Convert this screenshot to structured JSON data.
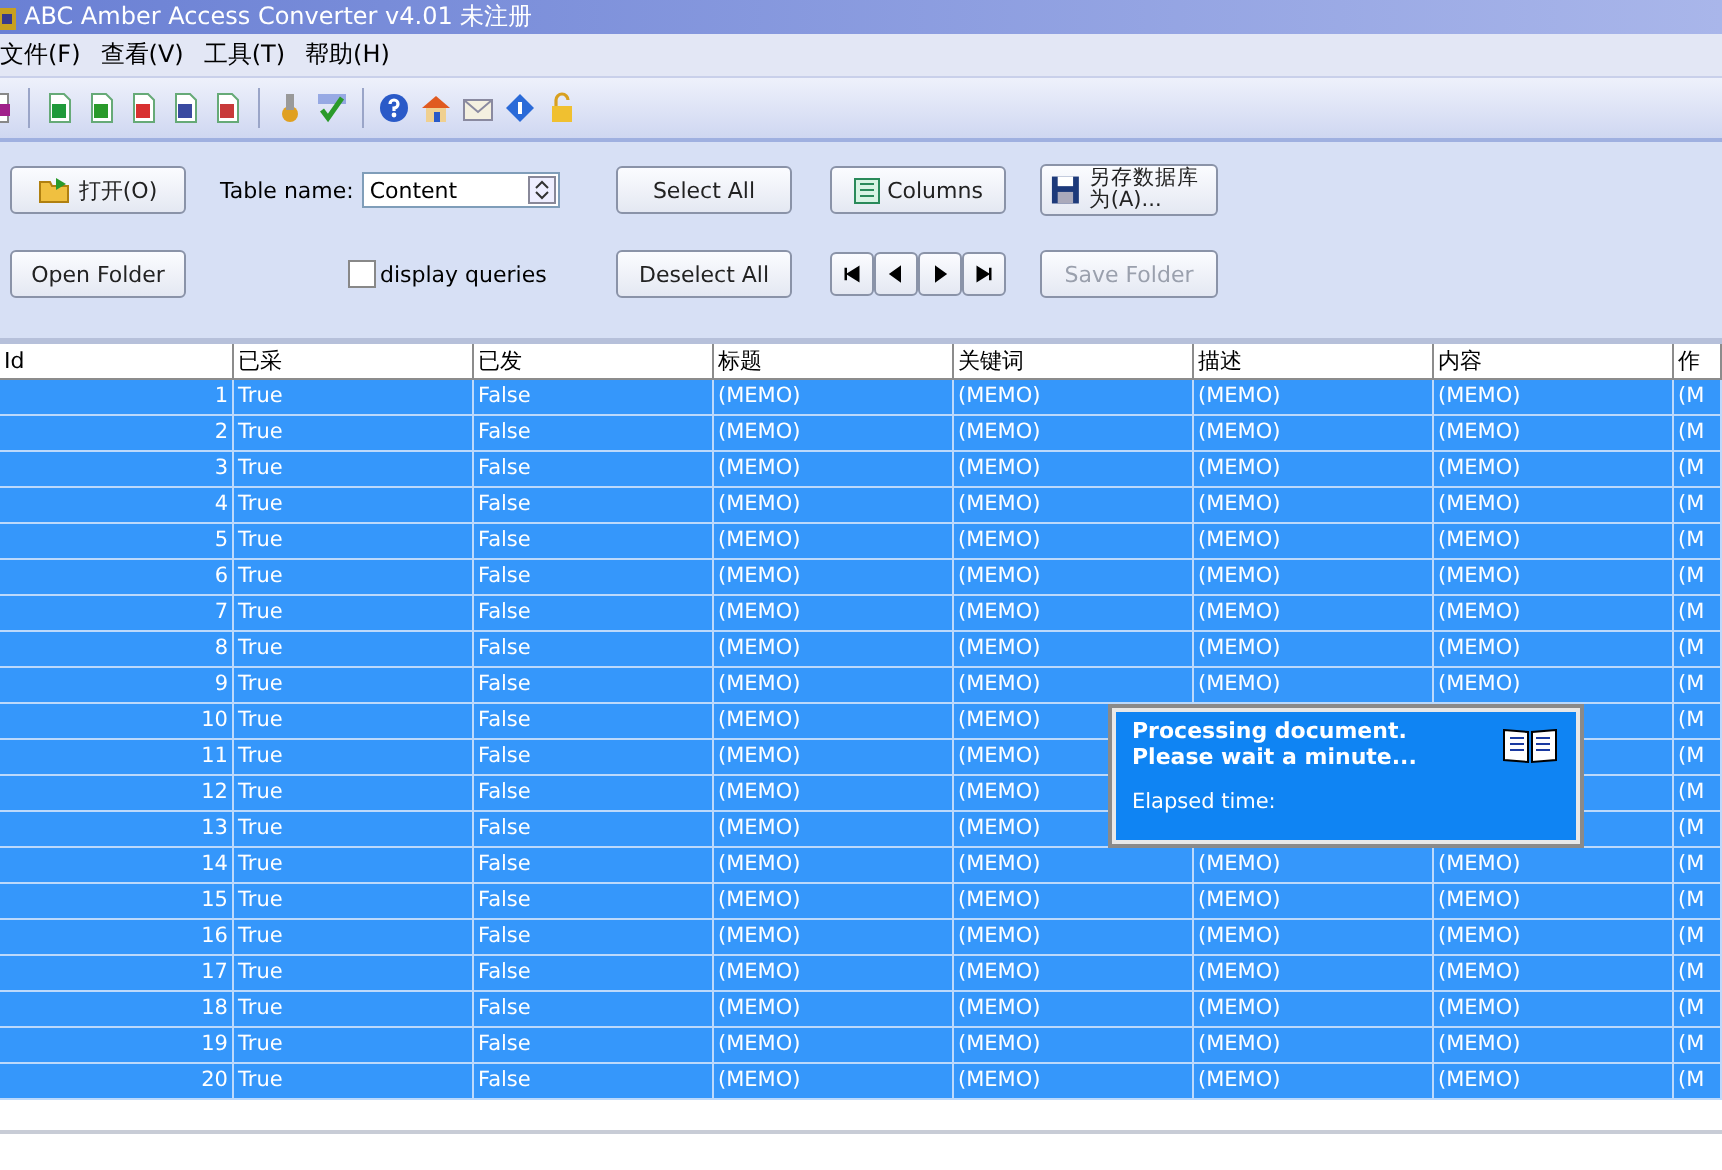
{
  "window": {
    "title": "ABC Amber Access Converter v4.01 未注册"
  },
  "menu": [
    "文件(F)",
    "查看(V)",
    "工具(T)",
    "帮助(H)"
  ],
  "controls": {
    "open_button": "打开(O)",
    "table_label": "Table name:",
    "table_select": "Content",
    "select_all": "Select All",
    "columns_button": "Columns",
    "save_db_button": "另存数据库为(A)...",
    "open_folder": "Open Folder",
    "display_queries": {
      "label": "display queries",
      "checked": false
    },
    "deselect_all": "Deselect All",
    "save_folder": {
      "label": "Save Folder",
      "disabled": true
    }
  },
  "table": {
    "columns": [
      "Id",
      "已采",
      "已发",
      "标题",
      "关键词",
      "描述",
      "内容",
      "作"
    ],
    "rows": [
      {
        "selected": true,
        "cells": [
          "1",
          "True",
          "False",
          "(MEMO)",
          "(MEMO)",
          "(MEMO)",
          "(MEMO)",
          "(M"
        ]
      },
      {
        "selected": true,
        "cells": [
          "2",
          "True",
          "False",
          "(MEMO)",
          "(MEMO)",
          "(MEMO)",
          "(MEMO)",
          "(M"
        ]
      },
      {
        "selected": true,
        "cells": [
          "3",
          "True",
          "False",
          "(MEMO)",
          "(MEMO)",
          "(MEMO)",
          "(MEMO)",
          "(M"
        ]
      },
      {
        "selected": true,
        "cells": [
          "4",
          "True",
          "False",
          "(MEMO)",
          "(MEMO)",
          "(MEMO)",
          "(MEMO)",
          "(M"
        ]
      },
      {
        "selected": true,
        "cells": [
          "5",
          "True",
          "False",
          "(MEMO)",
          "(MEMO)",
          "(MEMO)",
          "(MEMO)",
          "(M"
        ]
      },
      {
        "selected": true,
        "cells": [
          "6",
          "True",
          "False",
          "(MEMO)",
          "(MEMO)",
          "(MEMO)",
          "(MEMO)",
          "(M"
        ]
      },
      {
        "selected": true,
        "cells": [
          "7",
          "True",
          "False",
          "(MEMO)",
          "(MEMO)",
          "(MEMO)",
          "(MEMO)",
          "(M"
        ]
      },
      {
        "selected": true,
        "cells": [
          "8",
          "True",
          "False",
          "(MEMO)",
          "(MEMO)",
          "(MEMO)",
          "(MEMO)",
          "(M"
        ]
      },
      {
        "selected": true,
        "cells": [
          "9",
          "True",
          "False",
          "(MEMO)",
          "(MEMO)",
          "(MEMO)",
          "(MEMO)",
          "(M"
        ]
      },
      {
        "selected": true,
        "cells": [
          "10",
          "True",
          "False",
          "(MEMO)",
          "(MEMO)",
          null,
          null,
          "(M"
        ]
      },
      {
        "selected": true,
        "cells": [
          "11",
          "True",
          "False",
          "(MEMO)",
          "(MEMO)",
          null,
          null,
          "(M"
        ]
      },
      {
        "selected": true,
        "cells": [
          "12",
          "True",
          "False",
          "(MEMO)",
          "(MEMO)",
          null,
          null,
          "(M"
        ]
      },
      {
        "selected": true,
        "cells": [
          "13",
          "True",
          "False",
          "(MEMO)",
          "(MEMO)",
          null,
          null,
          "(M"
        ]
      },
      {
        "selected": true,
        "cells": [
          "14",
          "True",
          "False",
          "(MEMO)",
          "(MEMO)",
          "(MEMO)",
          "(MEMO)",
          "(M"
        ]
      },
      {
        "selected": true,
        "cells": [
          "15",
          "True",
          "False",
          "(MEMO)",
          "(MEMO)",
          "(MEMO)",
          "(MEMO)",
          "(M"
        ]
      },
      {
        "selected": true,
        "cells": [
          "16",
          "True",
          "False",
          "(MEMO)",
          "(MEMO)",
          "(MEMO)",
          "(MEMO)",
          "(M"
        ]
      },
      {
        "selected": true,
        "cells": [
          "17",
          "True",
          "False",
          "(MEMO)",
          "(MEMO)",
          "(MEMO)",
          "(MEMO)",
          "(M"
        ]
      },
      {
        "selected": true,
        "cells": [
          "18",
          "True",
          "False",
          "(MEMO)",
          "(MEMO)",
          "(MEMO)",
          "(MEMO)",
          "(M"
        ]
      },
      {
        "selected": true,
        "cells": [
          "19",
          "True",
          "False",
          "(MEMO)",
          "(MEMO)",
          "(MEMO)",
          "(MEMO)",
          "(M"
        ]
      },
      {
        "selected": true,
        "cells": [
          "20",
          "True",
          "False",
          "(MEMO)",
          "(MEMO)",
          "(MEMO)",
          "(MEMO)",
          "(M"
        ]
      }
    ]
  },
  "dialog": {
    "line_1": "Processing document.",
    "line_2": "Please wait a minute...",
    "elapsed_label": "Elapsed time:"
  }
}
